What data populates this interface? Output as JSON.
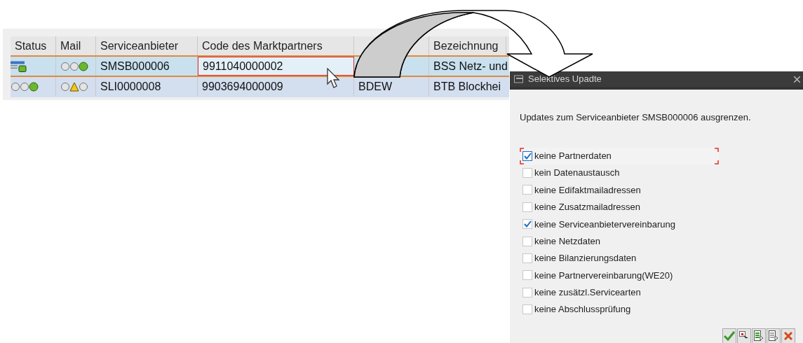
{
  "table": {
    "columns": [
      {
        "label": "Status"
      },
      {
        "label": "Mail"
      },
      {
        "label": "Serviceanbieter"
      },
      {
        "label": "Code des Marktpartners"
      },
      {},
      {
        "label": "Bezeichnung"
      }
    ],
    "rows": [
      {
        "selected": true,
        "status": {
          "kind": "document"
        },
        "mail": {
          "kind": "circle",
          "color": "#6ab82e"
        },
        "provider": "SMSB000006",
        "code": "9911040000002",
        "code_focused": true,
        "name": "BSS Netz- und"
      },
      {
        "selected": false,
        "status": {
          "kind": "circle",
          "color": "#6ab82e"
        },
        "mail": {
          "kind": "triangle",
          "color": "#f2c81c"
        },
        "provider": "SLI0000008",
        "code": "9903694000009",
        "code_focused": false,
        "column_5": "BDEW",
        "name": "BTB Blockhei"
      }
    ]
  },
  "dialog": {
    "title": "Selektives Upadte",
    "message": "Updates zum Serviceanbieter SMSB000006 ausgrenzen.",
    "options": [
      {
        "label": "keine Partnerdaten",
        "checked": true,
        "focused": true
      },
      {
        "label": "kein Datenaustausch",
        "checked": false,
        "focused": false
      },
      {
        "label": "keine Edifaktmailadressen",
        "checked": false,
        "focused": false
      },
      {
        "label": "keine Zusatzmailadressen",
        "checked": false,
        "focused": false
      },
      {
        "label": "keine Serviceanbietervereinbarung",
        "checked": true,
        "focused": false
      },
      {
        "label": "keine Netzdaten",
        "checked": false,
        "focused": false
      },
      {
        "label": "keine Bilanzierungsdaten",
        "checked": false,
        "focused": false
      },
      {
        "label": "keine Partnervereinbarung(WE20)",
        "checked": false,
        "focused": false
      },
      {
        "label": "keine zusätzl.Servicearten",
        "checked": false,
        "focused": false
      },
      {
        "label": "keine Abschlussprüfung",
        "checked": false,
        "focused": false
      }
    ]
  }
}
